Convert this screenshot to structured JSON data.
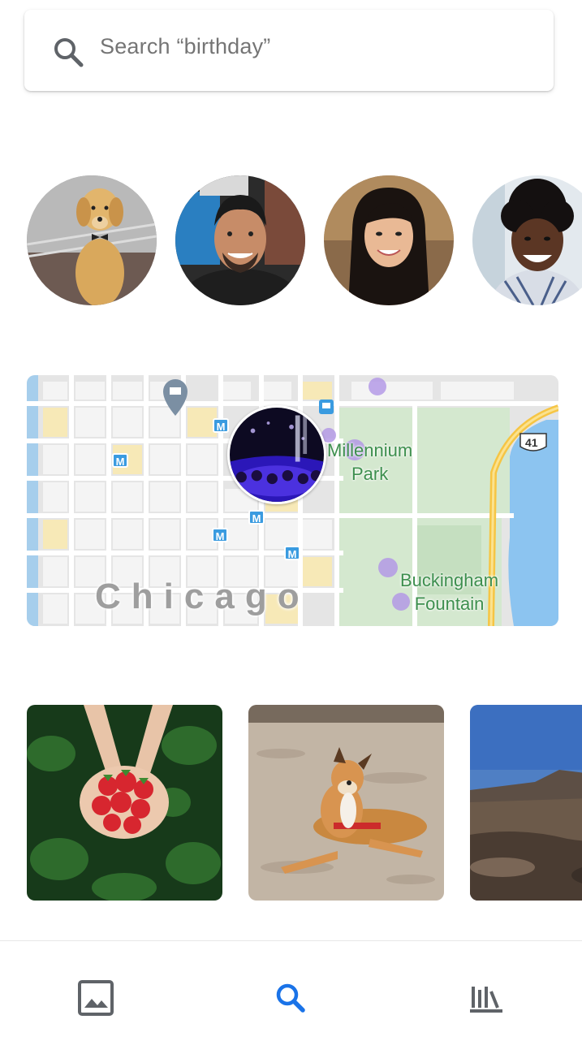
{
  "search": {
    "placeholder": "Search “birthday”",
    "icon": "search-icon"
  },
  "people": [
    {
      "name": "golden-retriever-dog"
    },
    {
      "name": "man-smiling"
    },
    {
      "name": "woman-smiling"
    },
    {
      "name": "woman-laughing"
    }
  ],
  "places": {
    "city": "Chicago",
    "labels": {
      "park": "Millennium\nPark",
      "fountain": "Buckingham\nFountain",
      "route": "41"
    },
    "metro_label": "M"
  },
  "things": [
    {
      "name": "strawberries"
    },
    {
      "name": "dog-on-beach"
    },
    {
      "name": "desert-landscape"
    }
  ],
  "nav": {
    "photos_icon": "photos-icon",
    "search_icon": "search-icon",
    "library_icon": "library-icon",
    "active": "search",
    "accent": "#1a73e8",
    "inactive": "#5f6368"
  }
}
